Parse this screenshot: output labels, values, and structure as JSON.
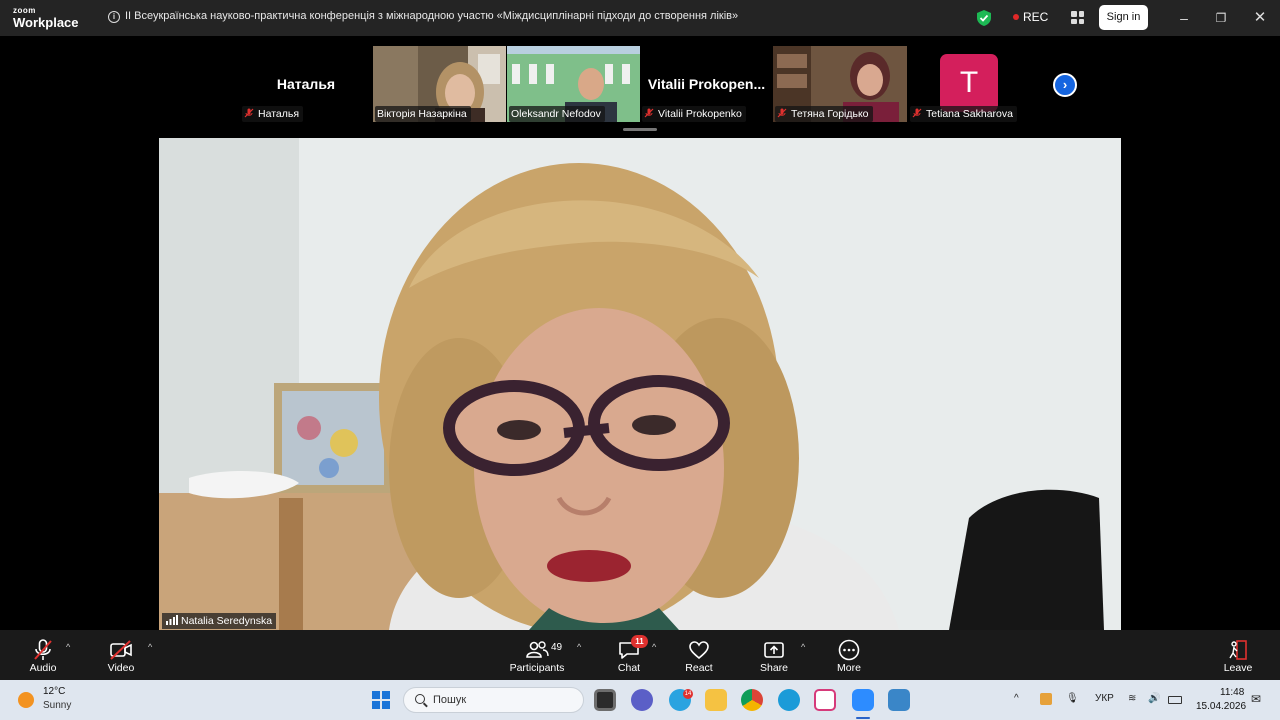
{
  "titlebar": {
    "logo_top": "zoom",
    "logo_bottom": "Workplace",
    "meeting_title": "II Всеукраїнська науково-практична конференція  з  міжнародною  участю «Міждисциплінарні підходи до створення ліків»",
    "rec_label": "REC",
    "signin_label": "Sign in"
  },
  "participants_strip": {
    "tiles": [
      {
        "big_name": "Наталья",
        "label": "Наталья",
        "muted": true
      },
      {
        "label": "Вікторія Назаркіна",
        "muted": false
      },
      {
        "label": "Oleksandr Nefodov",
        "muted": false
      },
      {
        "big_name": "Vitalii  Prokopen...",
        "label": "Vitalii Prokopenko",
        "muted": true
      },
      {
        "label": "Тетяна Горідько",
        "muted": true
      },
      {
        "avatar_letter": "T",
        "label": "Tetiana Sakharova",
        "muted": true
      }
    ]
  },
  "main_video": {
    "speaker_name": "Natalia Seredynska"
  },
  "controls": {
    "audio": "Audio",
    "video": "Video",
    "participants": "Participants",
    "participants_count": "49",
    "chat": "Chat",
    "chat_badge": "11",
    "react": "React",
    "share": "Share",
    "more": "More",
    "leave": "Leave"
  },
  "taskbar": {
    "temperature": "12°C",
    "condition": "Sunny",
    "search_placeholder": "Пошук",
    "telegram_badge": "14",
    "language": "УКР",
    "time": "11:48",
    "date": "15.04.2026"
  },
  "colors": {
    "titlebar_bg": "#242424",
    "controls_bg": "#1a1a1a",
    "rec_dot": "#e02828",
    "avatar_bg": "#d41f5c",
    "muted_icon": "#e0312f",
    "taskbar_bg": "#dfe6ef"
  }
}
